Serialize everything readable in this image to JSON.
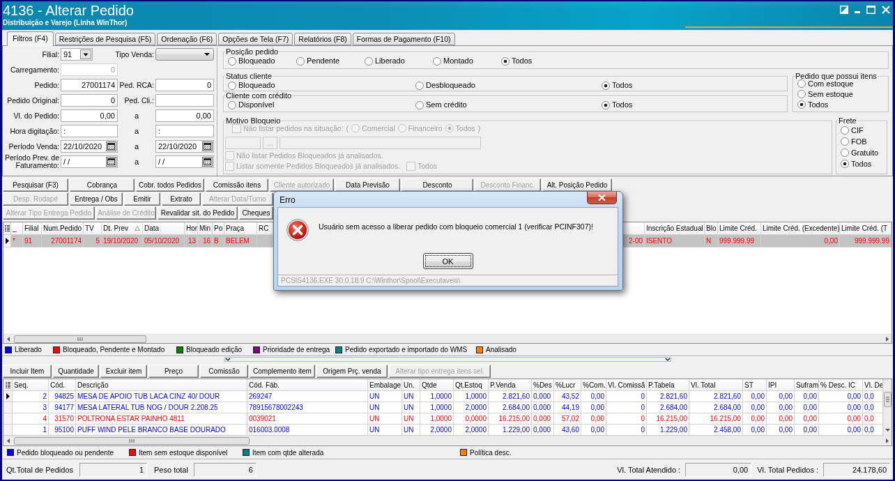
{
  "window": {
    "title": "4136 - Alterar Pedido",
    "subtitle": "Distribuição e Varejo (Linha WinThor)"
  },
  "tabs": [
    {
      "label": "Filtros (F4)",
      "selected": true
    },
    {
      "label": "Restrições de Pesquisa (F5)",
      "selected": false
    },
    {
      "label": "Ordenação (F6)",
      "selected": false
    },
    {
      "label": "Opções de Tela (F7)",
      "selected": false
    },
    {
      "label": "Relatórios (F8)",
      "selected": false
    },
    {
      "label": "Formas de Pagamento (F10)",
      "selected": false
    }
  ],
  "filter_fields": [
    {
      "label": "Filial:",
      "field": {
        "kind": "select",
        "value": "91",
        "disabled": false
      },
      "label2": "Tipo Venda:",
      "field2": {
        "kind": "select",
        "disabled": false
      }
    },
    {
      "label": "Carregamento:",
      "field": {
        "kind": "number",
        "value": "0",
        "disabled": true
      }
    },
    {
      "label": "Pedido:",
      "field": {
        "kind": "number",
        "value": "27001174",
        "disabled": false
      },
      "label2": "Ped. RCA:",
      "field2": {
        "kind": "number",
        "value": "0",
        "disabled": false
      }
    },
    {
      "label": "Pedido Original:",
      "field": {
        "kind": "number",
        "value": "0",
        "disabled": false
      },
      "label2": "Ped. Cli.:",
      "field2": {
        "kind": "text",
        "disabled": false
      }
    },
    {
      "label": "Vl. do Pedido:",
      "field": {
        "kind": "number",
        "value": "0,00",
        "disabled": false
      },
      "separator": "a",
      "field2": {
        "kind": "number",
        "value": "0,00",
        "disabled": false
      }
    },
    {
      "label": "Hora digitação:",
      "field": {
        "kind": "text",
        "value": ":",
        "disabled": false
      },
      "separator": "a",
      "field2": {
        "kind": "text",
        "value": ":",
        "disabled": false
      }
    },
    {
      "label": "Período Venda:",
      "field": {
        "kind": "date",
        "value": "22/10/2020",
        "disabled": false
      },
      "separator": "a",
      "field2": {
        "kind": "date",
        "value": "22/10/2020",
        "disabled": false
      }
    },
    {
      "label": "Período Prev. de Faturamento:",
      "field": {
        "kind": "date",
        "value": "/ /",
        "disabled": false
      },
      "separator": "a",
      "field2": {
        "kind": "date",
        "value": "/ /",
        "disabled": false
      }
    }
  ],
  "posicao_pedido": {
    "title": "Posição pedido",
    "options": [
      {
        "label": "Bloqueado",
        "selected": false
      },
      {
        "label": "Pendente",
        "selected": false
      },
      {
        "label": "Liberado",
        "selected": false
      },
      {
        "label": "Montado",
        "selected": false
      },
      {
        "label": "Todos",
        "selected": true
      }
    ]
  },
  "status_cliente": {
    "title": "Status cliente",
    "options": [
      {
        "label": "Bloqueado",
        "selected": false
      },
      {
        "label": "Desbloqueado",
        "selected": false
      },
      {
        "label": "Todos",
        "selected": true
      }
    ]
  },
  "cliente_com_credito": {
    "title": "Cliente com crédito",
    "options": [
      {
        "label": "Disponível",
        "selected": false
      },
      {
        "label": "Sem crédito",
        "selected": false
      },
      {
        "label": "Todos",
        "selected": true
      }
    ]
  },
  "pedido_que_possui_itens": {
    "title": "Pedido que possui itens",
    "options": [
      {
        "label": "Com estoque",
        "selected": false
      },
      {
        "label": "Sem estoque",
        "selected": false
      },
      {
        "label": "Todos",
        "selected": true
      }
    ]
  },
  "motivo_bloqueio": {
    "title": "Motivo Bloqueio",
    "disabled": true,
    "situation_check": {
      "label": "Não listar pedidos na situação:",
      "checked": false
    },
    "open_paren": "(",
    "options": [
      {
        "label": "Comercial",
        "selected": false
      },
      {
        "label": "Financeiro",
        "selected": false
      },
      {
        "label": "Todos",
        "selected": true
      }
    ],
    "close_paren": ")",
    "lookup_button": "...",
    "check_rows": [
      [
        {
          "label": "Não listar Pedidos Bloqueados já analisados.",
          "checked": false
        }
      ],
      [
        {
          "label": "Listar somente Pedidos Bloqueados já analisados.",
          "checked": false
        },
        {
          "label": "Todos",
          "checked": false
        }
      ]
    ]
  },
  "frete": {
    "title": "Frete",
    "options": [
      {
        "label": "CIF",
        "selected": false
      },
      {
        "label": "FOB",
        "selected": false
      },
      {
        "label": "Gratuito",
        "selected": false
      },
      {
        "label": "Todos",
        "selected": true
      }
    ]
  },
  "order_buttons": [
    [
      {
        "label": "Pesquisar (F3)",
        "disabled": false
      },
      {
        "label": "Cobrança",
        "disabled": false
      },
      {
        "label": "Cobr. todos Pedidos",
        "disabled": false
      },
      {
        "label": "Comissão itens",
        "disabled": false
      },
      {
        "label": "Cliente autorizado",
        "disabled": true
      },
      {
        "label": "Data Previsão",
        "disabled": false
      },
      {
        "label": "Desconto",
        "disabled": false
      },
      {
        "label": "Desconto Financ.",
        "disabled": true
      },
      {
        "label": "Alt. Posição Pedido",
        "disabled": false
      }
    ],
    [
      {
        "label": "Desp. Rodapé",
        "disabled": true
      },
      {
        "label": "Entrega / Obs",
        "disabled": false
      },
      {
        "label": "Emitir",
        "disabled": false
      },
      {
        "label": "Extrato",
        "disabled": false
      },
      {
        "label": "Alterar Data/Turno",
        "disabled": true
      }
    ],
    [
      {
        "label": "Alterar Tipo Entrega Pedido",
        "disabled": true
      },
      {
        "label": "Análise de Crédito",
        "disabled": true
      },
      {
        "label": "Revalidar sit. do Pedido",
        "disabled": false
      },
      {
        "label": "Cheques",
        "disabled": false
      }
    ]
  ],
  "orders_table": {
    "columns": [
      {
        "label": "_",
        "sorted": false
      },
      {
        "label": "Filial",
        "sorted": false
      },
      {
        "label": "Num.Pedido",
        "sorted": false
      },
      {
        "label": "TV",
        "sorted": false
      },
      {
        "label": "Dt. Prev",
        "sorted": true
      },
      {
        "label": "Data",
        "sorted": false
      },
      {
        "label": "Hor",
        "sorted": false
      },
      {
        "label": "Min",
        "sorted": false
      },
      {
        "label": "Po",
        "sorted": false
      },
      {
        "label": "Praça",
        "sorted": false
      },
      {
        "label": "RC",
        "sorted": false
      },
      {
        "sorted": false
      },
      {
        "label": "Inscrição Estadual",
        "sorted": false
      },
      {
        "label": "Blo",
        "sorted": false
      },
      {
        "label": "Limite Créd.",
        "sorted": false
      },
      {
        "label": "Limite Créd. (Excedente)",
        "sorted": false
      },
      {
        "label": "Limite Créd. (T",
        "sorted": false
      }
    ],
    "rows": [
      {
        "selected": true,
        "color": "#ff0000",
        "cells": [
          "*",
          "91",
          "27001174",
          "5",
          "19/10/2020",
          "05/10/2020",
          "13",
          "16",
          "B",
          "BELEM",
          null,
          "2-00",
          "ISENTO",
          "N",
          "999.999.99",
          "0,00",
          "999.999.99"
        ]
      }
    ]
  },
  "order_legend": [
    {
      "label": "Liberado",
      "color": "#0000ff"
    },
    {
      "label": "Bloqueado, Pendente e Montado",
      "color": "#ff0000"
    },
    {
      "label": "Bloqueado edição",
      "color": "#008000"
    },
    {
      "label": "Prioridade de entrega",
      "color": "#800080"
    },
    {
      "label": "Pedido exportado e importado do WMS",
      "color": "#008080"
    },
    {
      "label": "Analisado",
      "color": "#ff8000"
    }
  ],
  "item_buttons": [
    {
      "label": "Incluir Item",
      "disabled": false
    },
    {
      "label": "Quantidade",
      "disabled": false
    },
    {
      "label": "Excluir item",
      "disabled": false
    },
    {
      "label": "Preço",
      "disabled": false
    },
    {
      "label": "Comissão",
      "disabled": false
    },
    {
      "label": "Complemento item",
      "disabled": false
    },
    {
      "label": "Origem Prç. venda",
      "disabled": false
    },
    {
      "label": "Alterar tipo entrega itens sel.",
      "disabled": true
    }
  ],
  "items_table": {
    "columns": [
      "Seq.",
      "Cód.",
      "Descrição",
      "Cód. Fáb.",
      "Embalage",
      "Un.",
      "Qtde",
      "Qt.Estoq",
      "P.Venda",
      "%Des",
      "%Lucr",
      "%Com.",
      "Vl. Comissã",
      "P.Tabela",
      "Vl. Total",
      "ST",
      "IPI",
      "Sufram",
      "% Desc. IC",
      "Vl. De"
    ],
    "rows": [
      {
        "selected": true,
        "color": "#0000ff",
        "cells": [
          "2",
          "94825",
          "MESA DE APOIO TUB LACA CINZ 40/ DOUR",
          "269247",
          "UN",
          "UN",
          "1,0000",
          "1,0000",
          "2.821,60",
          "0,000",
          "43,52",
          "0,00",
          "0",
          "2.821,60",
          "2.821,60",
          "0,00",
          "0,00",
          "0,00",
          "0,00",
          "0,0"
        ]
      },
      {
        "selected": false,
        "color": "#0000ff",
        "cells": [
          "3",
          "94177",
          "MESA LATERAL TUB NOG / DOUR 2.208.25",
          "78915678002243",
          "UN",
          "UN",
          "1,0000",
          "2,0000",
          "2.684,00",
          "0,000",
          "44,19",
          "0,00",
          "0",
          "2.684,00",
          "2.684,00",
          "0,00",
          "0,00",
          "0,00",
          "0,00",
          "0,0"
        ]
      },
      {
        "selected": false,
        "color": "#ff0000",
        "cells": [
          "4",
          "31570",
          "POLTRONA ESTAR PAINHO 4811",
          "0039021",
          "UN",
          "UN",
          "1,0000",
          "0,0000",
          "16.215,00",
          "0,000",
          "57,02",
          "0,00",
          "0",
          "16.215,00",
          "16.215,00",
          "0,00",
          "0,00",
          "0,00",
          "0,00",
          "0,0"
        ]
      },
      {
        "selected": false,
        "color": "#0000ff",
        "cells": [
          "1",
          "95100",
          "PUFF WIND PELE BRANCO BASE DOURADO",
          "016003.0008",
          "UN",
          "UN",
          "2,0000",
          "2,0000",
          "1.229,00",
          "0,000",
          "43,60",
          "0,00",
          "0",
          "1.229,00",
          "2.458,00",
          "0,00",
          "0,00",
          "0,00",
          "0,00",
          "0,0"
        ]
      }
    ]
  },
  "item_legend": [
    {
      "label": "Pedido bloqueado ou pendente",
      "color": "#0000ff"
    },
    {
      "label": "Item sem estoque disponível",
      "color": "#ff0000"
    },
    {
      "label": "Item com qtde alterada",
      "color": "#008080"
    },
    {
      "label": "Política desc.",
      "color": "#ff8000"
    }
  ],
  "totals": [
    {
      "label": "Qt.Total de Pedidos",
      "value": "1"
    },
    {
      "label": "Peso total",
      "value": "6"
    }
  ],
  "grand_totals": [
    {
      "label": "Vl. Total Atendido :",
      "value": "0,00"
    },
    {
      "label": "Vl. Total Pedidos :",
      "value": "24.178,60"
    }
  ],
  "dialog": {
    "title": "Erro",
    "message": "Usuário sem acesso a liberar pedido com bloqueio comercial 1 (verificar PCINF307)!",
    "button": "OK",
    "status": "PCSIS4136.EXE 30.0.18.9 C:\\Winthor\\Spool\\Executaveis\\"
  }
}
